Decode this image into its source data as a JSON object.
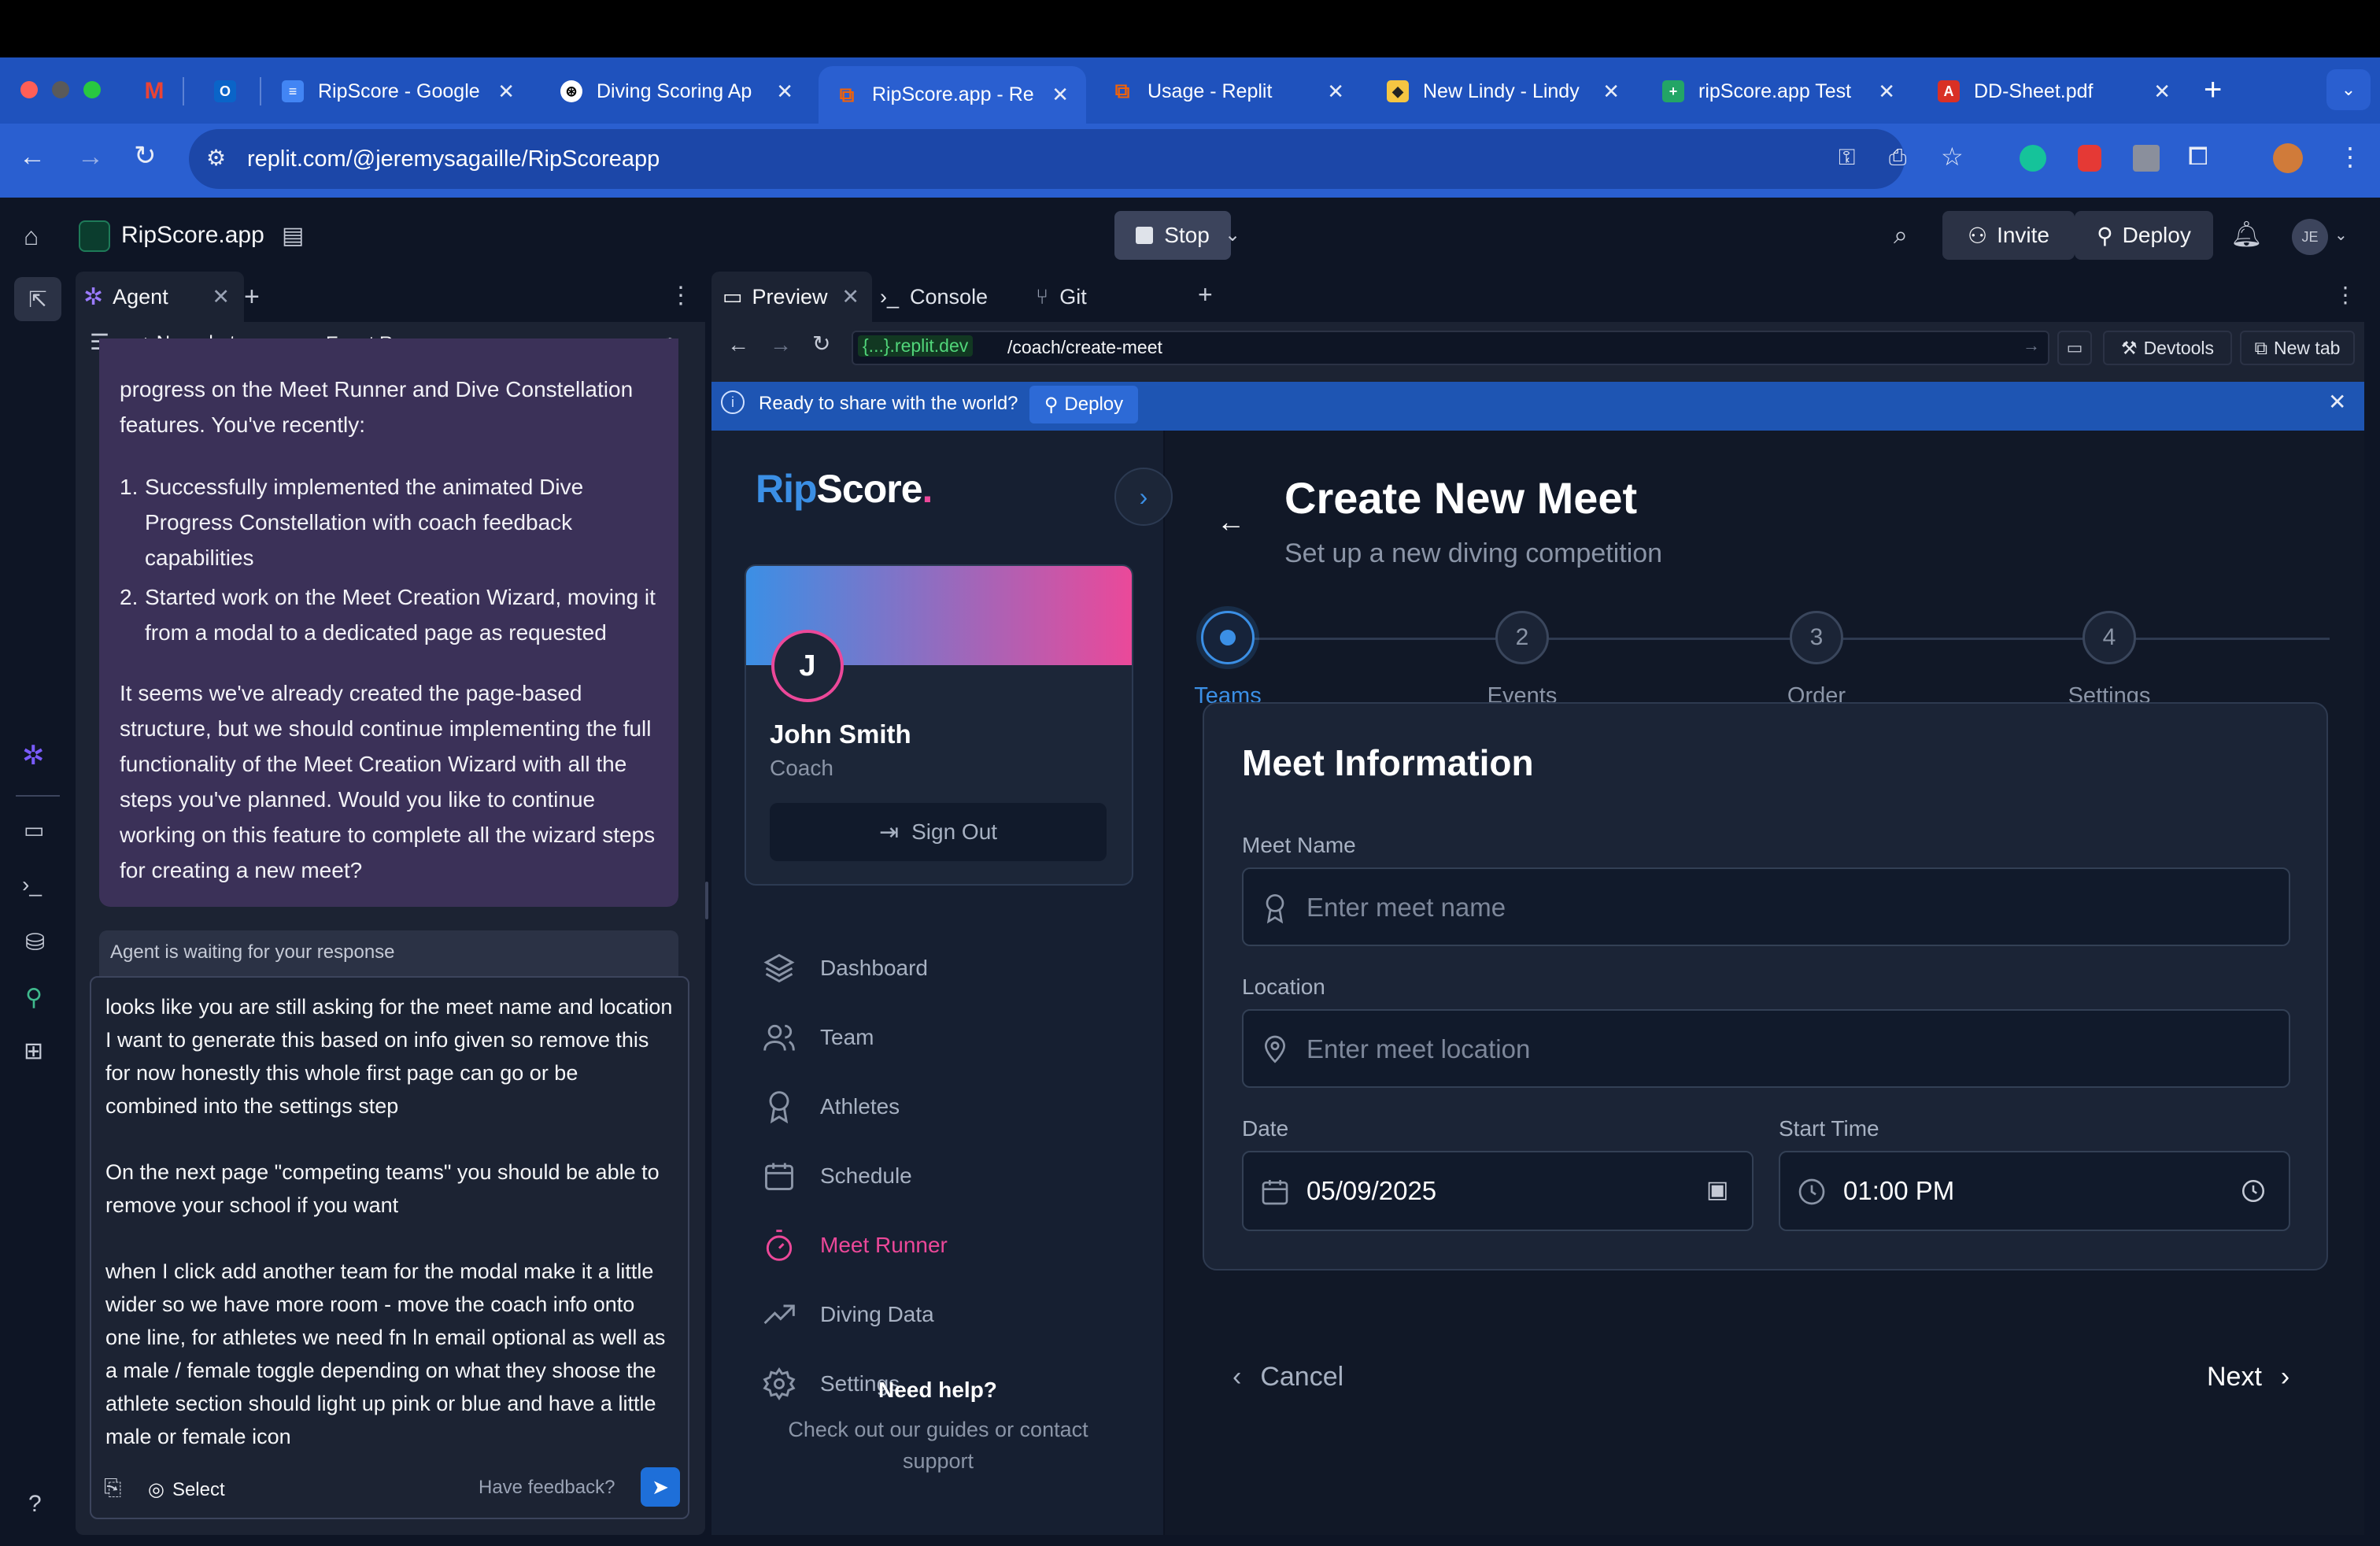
{
  "browser": {
    "tabs": [
      {
        "title": "",
        "icon": "gmail-icon"
      },
      {
        "title": "",
        "icon": "outlook-icon"
      },
      {
        "title": "RipScore - Google",
        "icon": "google-docs-icon"
      },
      {
        "title": "Diving Scoring Ap",
        "icon": "chatgpt-icon"
      },
      {
        "title": "RipScore.app - Re",
        "icon": "replit-icon"
      },
      {
        "title": "Usage - Replit",
        "icon": "replit-icon"
      },
      {
        "title": "New Lindy - Lindy",
        "icon": "lindy-icon"
      },
      {
        "title": "ripScore.app Test",
        "icon": "google-sheets-icon"
      },
      {
        "title": "DD-Sheet.pdf",
        "icon": "pdf-icon"
      }
    ],
    "url": "replit.com/@jeremysagaille/RipScoreapp"
  },
  "replit": {
    "project_name": "RipScore.app",
    "stop_label": "Stop",
    "invite_label": "Invite",
    "deploy_label": "Deploy",
    "avatar_initials": "JE",
    "agent_tab": "Agent",
    "new_chat": "New chat",
    "chat_title": "Event Re...",
    "agent_message_1": "progress on the Meet Runner and Dive Constellation features. You've recently:",
    "agent_list": [
      "Successfully implemented the animated Dive Progress Constellation with coach feedback capabilities",
      "Started work on the Meet Creation Wizard, moving it from a modal to a dedicated page as requested"
    ],
    "agent_message_2": "It seems we've already created the page-based structure, but we should continue implementing the full functionality of the Meet Creation Wizard with all the steps you've planned. Would you like to continue working on this feature to complete all the wizard steps for creating a new meet?",
    "waiting_label": "Agent is waiting for your response",
    "user_input_p1": "looks like you are still asking for the meet name and location I want to generate this based on info given so remove this for now honestly this whole first page can go or be combined into the settings step",
    "user_input_p2": "On the next page \"competing teams\" you should be able to remove your school if you want",
    "user_input_p3": "when I click add another team for the modal make it a little wider so we have more room - move the coach info onto one line, for athletes we need fn ln email optional as well as a male / female toggle depending on what they shoose the athlete section should light up pink or blue and have a little male or female icon",
    "select_label": "Select",
    "feedback_label": "Have feedback?",
    "preview_tab": "Preview",
    "console_tab": "Console",
    "git_tab": "Git",
    "preview_domain": "{...}.replit.dev",
    "preview_path": "/coach/create-meet",
    "devtools_label": "Devtools",
    "newtab_label": "New tab",
    "banner_text": "Ready to share with the world?",
    "banner_deploy": "Deploy"
  },
  "site": {
    "logo_rip": "Rip",
    "logo_score": "Score",
    "logo_dot": ".",
    "profile_initial": "J",
    "profile_name": "John Smith",
    "profile_role": "Coach",
    "sign_out": "Sign Out",
    "nav": [
      {
        "label": "Dashboard",
        "icon": "layers-icon"
      },
      {
        "label": "Team",
        "icon": "users-icon"
      },
      {
        "label": "Athletes",
        "icon": "award-icon"
      },
      {
        "label": "Schedule",
        "icon": "calendar-icon"
      },
      {
        "label": "Meet Runner",
        "icon": "timer-icon"
      },
      {
        "label": "Diving Data",
        "icon": "trending-icon"
      },
      {
        "label": "Settings",
        "icon": "settings-icon"
      }
    ],
    "help_title": "Need help?",
    "help_text": "Check out our guides or contact support",
    "page_title": "Create New Meet",
    "page_subtitle": "Set up a new diving competition",
    "steps": [
      {
        "num": "1",
        "label": "Teams"
      },
      {
        "num": "2",
        "label": "Events"
      },
      {
        "num": "3",
        "label": "Order"
      },
      {
        "num": "4",
        "label": "Settings"
      }
    ],
    "section_title": "Meet Information",
    "meet_name_label": "Meet Name",
    "meet_name_placeholder": "Enter meet name",
    "location_label": "Location",
    "location_placeholder": "Enter meet location",
    "date_label": "Date",
    "date_value": "05/09/2025",
    "time_label": "Start Time",
    "time_value": "01:00 PM",
    "cancel_label": "Cancel",
    "next_label": "Next"
  },
  "colors": {
    "accent_pink": "#ec4899",
    "accent_blue": "#3b82f6",
    "chrome_blue": "#2a5fd0"
  }
}
